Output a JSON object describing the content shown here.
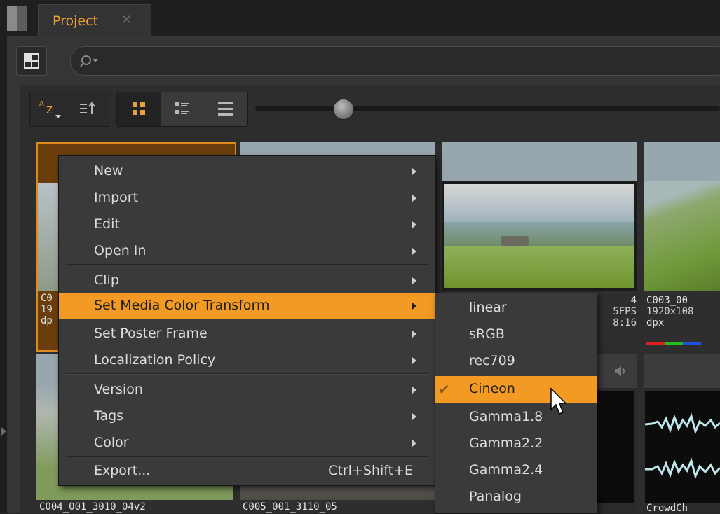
{
  "panel": {
    "tab_title": "Project",
    "close_glyph": "✕"
  },
  "search": {
    "placeholder": "",
    "icon": "search-icon"
  },
  "toolbar": {
    "sort_label_a": "A",
    "sort_label_z": "Z",
    "icons": [
      "sort-az-icon",
      "sort-direction-icon",
      "grid-view-icon",
      "detail-view-icon",
      "list-view-icon"
    ],
    "thumbnail_size": 0.19
  },
  "clips": [
    {
      "line1": "C0",
      "line2": "19",
      "line3": "dp"
    },
    {
      "line1": "4",
      "line2": "5FPS",
      "line3": "8:16"
    },
    {
      "line1": "C003_00",
      "line2": "1920x108",
      "line3": "dpx"
    },
    {
      "line1": "C004_001_3010_04v2",
      "line2": "",
      "line3": ""
    },
    {
      "line1": "C005_001_3110_05",
      "line2": "",
      "line3": ""
    },
    {
      "line1": "CrowdCh",
      "line2": "",
      "line3": ""
    }
  ],
  "context_menu": {
    "items": [
      {
        "label": "New",
        "submenu": true
      },
      {
        "label": "Import",
        "submenu": true
      },
      {
        "label": "Edit",
        "submenu": true
      },
      {
        "label": "Open In",
        "submenu": true
      },
      {
        "label": "Clip",
        "submenu": true
      },
      {
        "label": "Set Media Color Transform",
        "submenu": true,
        "highlighted": true
      },
      {
        "label": "Set Poster Frame",
        "submenu": true
      },
      {
        "label": "Localization Policy",
        "submenu": true
      },
      {
        "label": "Version",
        "submenu": true
      },
      {
        "label": "Tags",
        "submenu": true
      },
      {
        "label": "Color",
        "submenu": true
      },
      {
        "label": "Export...",
        "shortcut": "Ctrl+Shift+E"
      }
    ]
  },
  "color_transform_menu": {
    "items": [
      "linear",
      "sRGB",
      "rec709",
      "Cineon",
      "Gamma1.8",
      "Gamma2.2",
      "Gamma2.4",
      "Panalog"
    ],
    "selected": "Cineon",
    "check_glyph": "✔"
  },
  "colors": {
    "accent": "#f29a23",
    "tab_text": "#f3a233",
    "menu_bg": "#3a3a3a"
  }
}
